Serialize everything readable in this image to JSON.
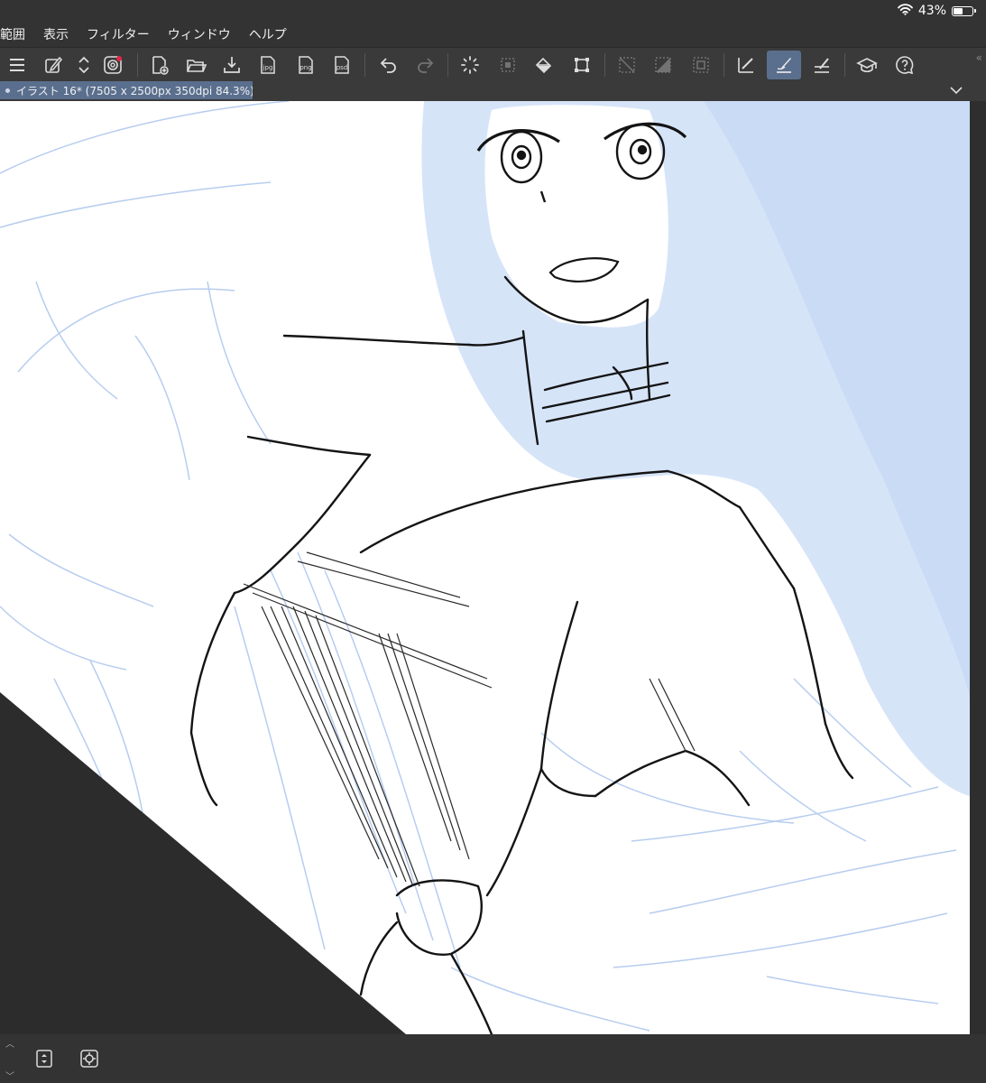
{
  "status_bar": {
    "battery_percent": "43%"
  },
  "menu": [
    "範囲",
    "表示",
    "フィルター",
    "ウィンドウ",
    "ヘルプ"
  ],
  "toolbar": {
    "jpg_label": "jpg",
    "png_label": "png",
    "psd_label": "psd",
    "icons": [
      "menu-icon",
      "edit-icon",
      "updown-icon",
      "companion-icon",
      "new-canvas-icon",
      "open-folder-icon",
      "save-icon",
      "export-jpg-icon",
      "export-png-icon",
      "export-psd-icon",
      "undo-icon",
      "redo-icon",
      "loading-icon",
      "selection-icon",
      "fill-icon",
      "transform-icon",
      "deselect-icon",
      "invert-selection-icon",
      "selection-border-icon",
      "ruler-icon",
      "brush-icon",
      "ruler-snap-icon",
      "learn-icon",
      "help-icon"
    ]
  },
  "document": {
    "tab_title": "イラスト 16* (7505 x 2500px 350dpi 84.3%)"
  },
  "colors": {
    "ui_dark": "#333333",
    "toolbar": "#3a3a3a",
    "active_tab": "#5a6f8e",
    "canvas_bg": "#ffffff",
    "sketch_blue": "#d6e4f8",
    "sketch_stroke": "#b7cdef",
    "ink": "#141414"
  }
}
